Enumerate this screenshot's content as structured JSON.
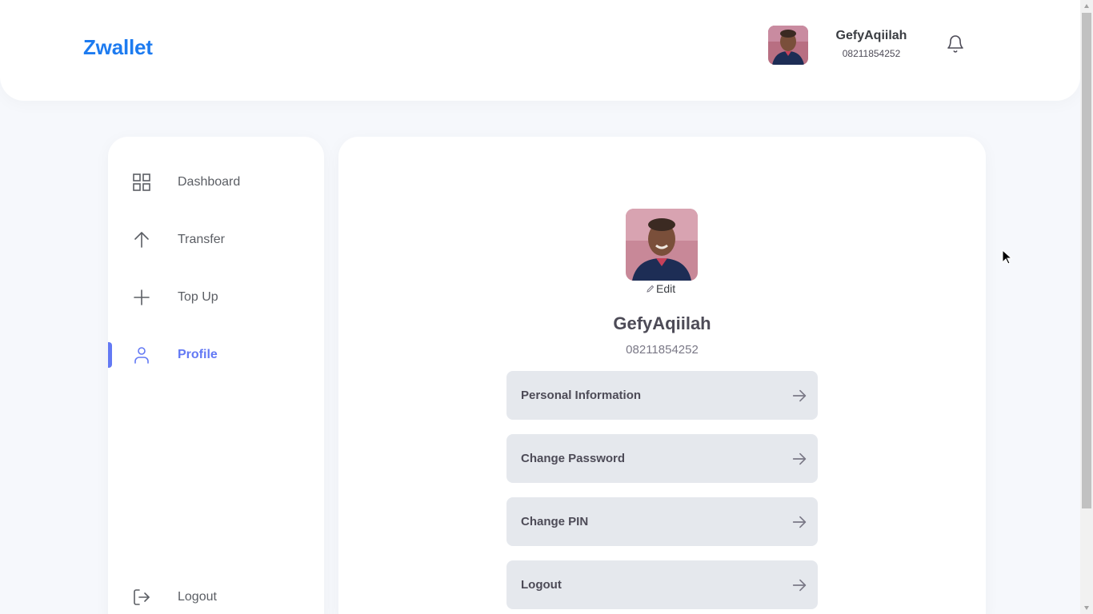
{
  "header": {
    "brand": "Zwallet",
    "user_name": "GefyAqiilah",
    "user_phone": "08211854252",
    "bell_icon": "bell-icon"
  },
  "sidebar": {
    "items": [
      {
        "label": "Dashboard",
        "icon": "grid-icon"
      },
      {
        "label": "Transfer",
        "icon": "arrow-up-icon"
      },
      {
        "label": "Top Up",
        "icon": "plus-icon"
      },
      {
        "label": "Profile",
        "icon": "user-icon",
        "active": true
      }
    ],
    "logout": {
      "label": "Logout",
      "icon": "logout-icon"
    }
  },
  "profile": {
    "edit_label": "Edit",
    "name": "GefyAqiilah",
    "phone": "08211854252",
    "menu": [
      {
        "label": "Personal Information"
      },
      {
        "label": "Change Password"
      },
      {
        "label": "Change PIN"
      },
      {
        "label": "Logout"
      }
    ]
  },
  "colors": {
    "brand": "#1d7bf0",
    "accent": "#6379f4",
    "background": "#f6f8fc",
    "menu_button": "#e5e8ed"
  }
}
